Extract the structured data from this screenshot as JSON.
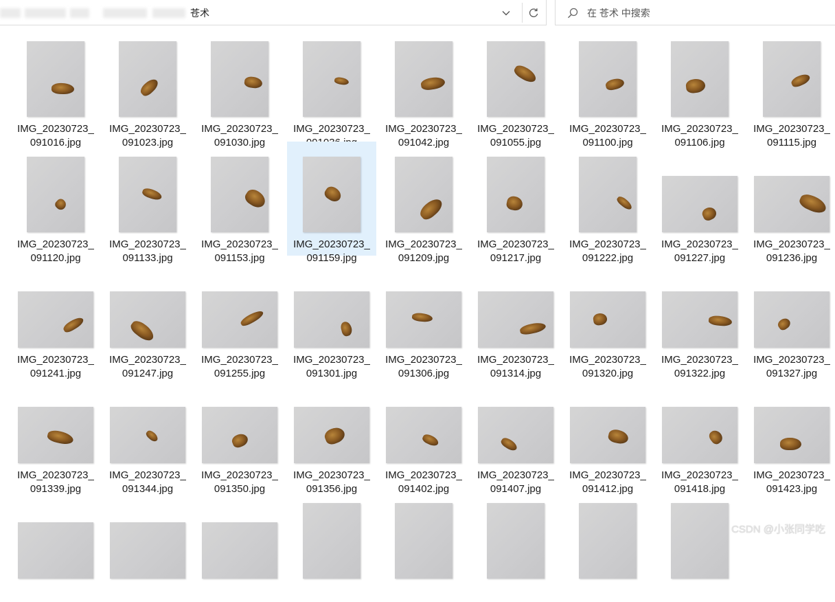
{
  "address_bar": {
    "crumbs": [
      "此电脑",
      "本地磁盘",
      "数据",
      "图片",
      "苍术"
    ],
    "visible_crumb": "苍术"
  },
  "search": {
    "placeholder": "在 苍术 中搜索",
    "value": ""
  },
  "icons": {
    "chevron": "chevron-down-icon",
    "refresh": "refresh-icon",
    "search": "search-icon"
  },
  "colors": {
    "selection": "#e1f0fc",
    "text": "#1a1a1a"
  },
  "files": [
    {
      "line1": "IMG_20230723_",
      "line2": "091016.jpg",
      "orientation": "portrait",
      "selected": false
    },
    {
      "line1": "IMG_20230723_",
      "line2": "091023.jpg",
      "orientation": "portrait",
      "selected": false
    },
    {
      "line1": "IMG_20230723_",
      "line2": "091030.jpg",
      "orientation": "portrait",
      "selected": false
    },
    {
      "line1": "IMG_20230723_",
      "line2": "091036.jpg",
      "orientation": "portrait",
      "selected": false
    },
    {
      "line1": "IMG_20230723_",
      "line2": "091042.jpg",
      "orientation": "portrait",
      "selected": false
    },
    {
      "line1": "IMG_20230723_",
      "line2": "091055.jpg",
      "orientation": "portrait",
      "selected": false
    },
    {
      "line1": "IMG_20230723_",
      "line2": "091100.jpg",
      "orientation": "portrait",
      "selected": false
    },
    {
      "line1": "IMG_20230723_",
      "line2": "091106.jpg",
      "orientation": "portrait",
      "selected": false
    },
    {
      "line1": "IMG_20230723_",
      "line2": "091115.jpg",
      "orientation": "portrait",
      "selected": false
    },
    {
      "line1": "IMG_20230723_",
      "line2": "091120.jpg",
      "orientation": "portrait",
      "selected": false
    },
    {
      "line1": "IMG_20230723_",
      "line2": "091133.jpg",
      "orientation": "portrait",
      "selected": false
    },
    {
      "line1": "IMG_20230723_",
      "line2": "091153.jpg",
      "orientation": "portrait",
      "selected": false
    },
    {
      "line1": "IMG_20230723_",
      "line2": "091159.jpg",
      "orientation": "portrait",
      "selected": true
    },
    {
      "line1": "IMG_20230723_",
      "line2": "091209.jpg",
      "orientation": "portrait",
      "selected": false
    },
    {
      "line1": "IMG_20230723_",
      "line2": "091217.jpg",
      "orientation": "portrait",
      "selected": false
    },
    {
      "line1": "IMG_20230723_",
      "line2": "091222.jpg",
      "orientation": "portrait",
      "selected": false
    },
    {
      "line1": "IMG_20230723_",
      "line2": "091227.jpg",
      "orientation": "landscape",
      "selected": false
    },
    {
      "line1": "IMG_20230723_",
      "line2": "091236.jpg",
      "orientation": "landscape",
      "selected": false
    },
    {
      "line1": "IMG_20230723_",
      "line2": "091241.jpg",
      "orientation": "landscape",
      "selected": false
    },
    {
      "line1": "IMG_20230723_",
      "line2": "091247.jpg",
      "orientation": "landscape",
      "selected": false
    },
    {
      "line1": "IMG_20230723_",
      "line2": "091255.jpg",
      "orientation": "landscape",
      "selected": false
    },
    {
      "line1": "IMG_20230723_",
      "line2": "091301.jpg",
      "orientation": "landscape",
      "selected": false
    },
    {
      "line1": "IMG_20230723_",
      "line2": "091306.jpg",
      "orientation": "landscape",
      "selected": false
    },
    {
      "line1": "IMG_20230723_",
      "line2": "091314.jpg",
      "orientation": "landscape",
      "selected": false
    },
    {
      "line1": "IMG_20230723_",
      "line2": "091320.jpg",
      "orientation": "landscape",
      "selected": false
    },
    {
      "line1": "IMG_20230723_",
      "line2": "091322.jpg",
      "orientation": "landscape",
      "selected": false
    },
    {
      "line1": "IMG_20230723_",
      "line2": "091327.jpg",
      "orientation": "landscape",
      "selected": false
    },
    {
      "line1": "IMG_20230723_",
      "line2": "091339.jpg",
      "orientation": "landscape",
      "selected": false
    },
    {
      "line1": "IMG_20230723_",
      "line2": "091344.jpg",
      "orientation": "landscape",
      "selected": false
    },
    {
      "line1": "IMG_20230723_",
      "line2": "091350.jpg",
      "orientation": "landscape",
      "selected": false
    },
    {
      "line1": "IMG_20230723_",
      "line2": "091356.jpg",
      "orientation": "landscape",
      "selected": false
    },
    {
      "line1": "IMG_20230723_",
      "line2": "091402.jpg",
      "orientation": "landscape",
      "selected": false
    },
    {
      "line1": "IMG_20230723_",
      "line2": "091407.jpg",
      "orientation": "landscape",
      "selected": false
    },
    {
      "line1": "IMG_20230723_",
      "line2": "091412.jpg",
      "orientation": "landscape",
      "selected": false
    },
    {
      "line1": "IMG_20230723_",
      "line2": "091418.jpg",
      "orientation": "landscape",
      "selected": false
    },
    {
      "line1": "IMG_20230723_",
      "line2": "091423.jpg",
      "orientation": "landscape",
      "selected": false
    }
  ],
  "partial_row": [
    {
      "orientation": "landscape"
    },
    {
      "orientation": "landscape"
    },
    {
      "orientation": "landscape"
    },
    {
      "orientation": "portrait"
    },
    {
      "orientation": "portrait"
    },
    {
      "orientation": "portrait"
    },
    {
      "orientation": "portrait"
    },
    {
      "orientation": "portrait"
    }
  ],
  "watermark": "CSDN @小张同学吃"
}
